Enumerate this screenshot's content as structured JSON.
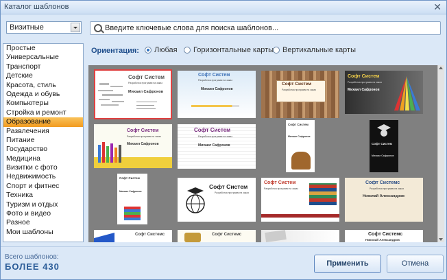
{
  "window": {
    "title": "Каталог шаблонов"
  },
  "sidebar": {
    "selected_type": "Визитные",
    "categories": [
      "Простые",
      "Универсальные",
      "Транспорт",
      "Детские",
      "Красота, стиль",
      "Одежда и обувь",
      "Компьютеры",
      "Стройка и ремонт",
      "Образование",
      "Развлечения",
      "Питание",
      "Государство",
      "Медицина",
      "Визитки с фото",
      "Недвижимость",
      "Спорт и фитнес",
      "Техника",
      "Туризм и отдых",
      "Фото и видео",
      "Разное",
      "Мои шаблоны"
    ],
    "selected_index": 8
  },
  "search": {
    "placeholder": "Введите ключевые слова для поиска шаблонов..."
  },
  "orientation": {
    "label": "Ориентация:",
    "options": [
      "Любая",
      "Горизонтальные карты",
      "Вертикальные карты"
    ],
    "selected_index": 0
  },
  "cards": {
    "company_a": "Софт Систем",
    "company_b": "Софт Системс",
    "person_a": "Михаил Сафронов",
    "person_b": "Николай Александров",
    "tagline": "Разработка программ на заказ"
  },
  "footer": {
    "total_label": "Всего шаблонов:",
    "total_value": "БОЛЕЕ 430",
    "apply_label": "Применить",
    "cancel_label": "Отмена"
  }
}
